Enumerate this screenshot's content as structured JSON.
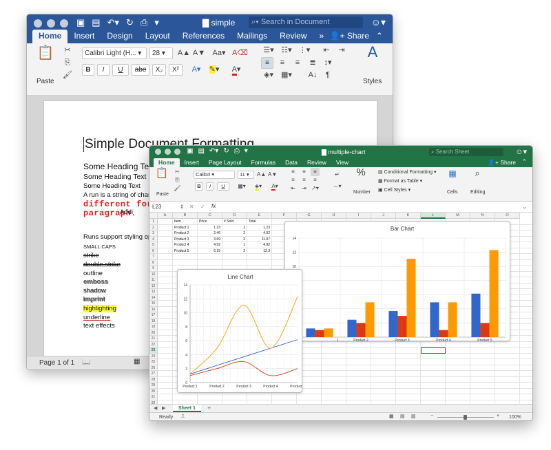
{
  "word": {
    "app": "Word",
    "doc_title": "simple",
    "search_placeholder": "Search in Document",
    "tabs": [
      "Home",
      "Insert",
      "Design",
      "Layout",
      "References",
      "Mailings",
      "Review"
    ],
    "more_tabs": "»",
    "share": "Share",
    "ribbon": {
      "paste": "Paste",
      "font_name": "Calibri Light (H...",
      "font_size": "28",
      "bold": "B",
      "italic": "I",
      "underline": "U",
      "strikethrough": "abe",
      "subscript": "X₂",
      "superscript": "X²",
      "styles": "Styles"
    },
    "document": {
      "title": "Simple Document Formatting",
      "lines": [
        {
          "text": "Some Heading Text",
          "style": "h1"
        },
        {
          "text": "Some Heading Text",
          "style": "h2"
        },
        {
          "text": "Some Heading Text",
          "style": "h3"
        },
        {
          "text": "A run is a string of charac",
          "style": "normal"
        },
        {
          "text": "different form",
          "style": "red-mono"
        },
        {
          "text": "paragraph.",
          "style": "red-mono"
        },
        {
          "text": "Addi",
          "style": "normal"
        },
        {
          "text": "Runs support styling optio",
          "style": "normal"
        },
        {
          "text": "SMALL CAPS",
          "style": "smallcaps"
        },
        {
          "text": "strike",
          "style": "strike"
        },
        {
          "text": "double strike",
          "style": "dstrike"
        },
        {
          "text": "outline",
          "style": "normal"
        },
        {
          "text": "emboss",
          "style": "emboss"
        },
        {
          "text": "shadow",
          "style": "shadow"
        },
        {
          "text": "imprint",
          "style": "imprint"
        },
        {
          "text": "highlighting",
          "style": "highlight"
        },
        {
          "text": "underline",
          "style": "underline"
        },
        {
          "text": "text effects",
          "style": "normal"
        }
      ]
    },
    "status": {
      "page": "Page 1 of 1"
    }
  },
  "excel": {
    "app": "Excel",
    "doc_title": "multiple-chart",
    "search_placeholder": "Search Sheet",
    "tabs": [
      "Home",
      "Insert",
      "Page Layout",
      "Formulas",
      "Data",
      "Review",
      "View"
    ],
    "share": "Share",
    "ribbon": {
      "paste": "Paste",
      "font_name": "Calibri",
      "font_size": "11",
      "bold": "B",
      "italic": "I",
      "underline": "U",
      "number": "Number",
      "percent": "%",
      "conditional_formatting": "Conditional Formatting",
      "format_as_table": "Format as Table",
      "cell_styles": "Cell Styles",
      "cells": "Cells",
      "editing": "Editing"
    },
    "name_box": "L23",
    "fx": "fx",
    "columns": [
      "A",
      "B",
      "C",
      "D",
      "E",
      "F",
      "G",
      "H",
      "I",
      "J",
      "K",
      "L",
      "M",
      "N",
      "O"
    ],
    "active_column": "L",
    "rows": [
      "1",
      "2",
      "3",
      "4",
      "5",
      "6",
      "7",
      "8",
      "9",
      "10",
      "11",
      "12",
      "13",
      "14",
      "15",
      "16",
      "17",
      "18",
      "19",
      "20",
      "21",
      "22",
      "23",
      "24",
      "25",
      "26",
      "27",
      "28",
      "29",
      "30",
      "31",
      "32"
    ],
    "active_row": "23",
    "table": {
      "headers": [
        "Item",
        "Price",
        "# Sold",
        "Total"
      ],
      "rows": [
        [
          "Product 1",
          "1.23",
          "1",
          "1.23"
        ],
        [
          "Product 2",
          "2.46",
          "2",
          "4.92"
        ],
        [
          "Product 3",
          "3.69",
          "3",
          "11.07"
        ],
        [
          "Product 4",
          "4.92",
          "1",
          "4.92"
        ],
        [
          "Product 5",
          "6.15",
          "2",
          "12.3"
        ]
      ]
    },
    "sheet_tab": "Sheet 1",
    "add_sheet": "+",
    "status": {
      "ready": "Ready",
      "zoom": "100%"
    }
  },
  "chart_data": [
    {
      "type": "bar",
      "title": "Bar Chart",
      "categories": [
        "Product 1",
        "Product 2",
        "Product 3",
        "Product 4",
        "Product 5"
      ],
      "visible_category_labels": [
        "1",
        "Product 2",
        "Product 3",
        "Product 4",
        "Product 5"
      ],
      "series": [
        {
          "values": [
            1.23,
            2.46,
            3.69,
            4.92,
            6.15
          ],
          "color": "#3366cc"
        },
        {
          "values": [
            1,
            2,
            3,
            1,
            2
          ],
          "color": "#dc3912"
        },
        {
          "values": [
            1.23,
            4.92,
            11.07,
            4.92,
            12.3
          ],
          "color": "#ff9900"
        }
      ],
      "ylim": [
        0,
        14
      ],
      "yticks": [
        0,
        2,
        4,
        6,
        8,
        10,
        12,
        14
      ],
      "visible_yticks": [
        "14",
        "12",
        "10",
        "8"
      ],
      "grid": true
    },
    {
      "type": "line",
      "title": "Line Chart",
      "categories": [
        "Product 1",
        "Product 2",
        "Product 3",
        "Product 4",
        "Product 5"
      ],
      "series": [
        {
          "values": [
            1.23,
            2.46,
            3.69,
            4.92,
            6.15
          ],
          "color": "#3366cc"
        },
        {
          "values": [
            1,
            2,
            3,
            1,
            2
          ],
          "color": "#dc3912"
        },
        {
          "values": [
            1.23,
            4.92,
            11.07,
            4.92,
            12.3
          ],
          "color": "#ff9900"
        }
      ],
      "ylim": [
        0,
        14
      ],
      "yticks": [
        "0",
        "2",
        "4",
        "6",
        "8",
        "10",
        "12",
        "14"
      ],
      "smooth": true,
      "grid": true
    }
  ]
}
